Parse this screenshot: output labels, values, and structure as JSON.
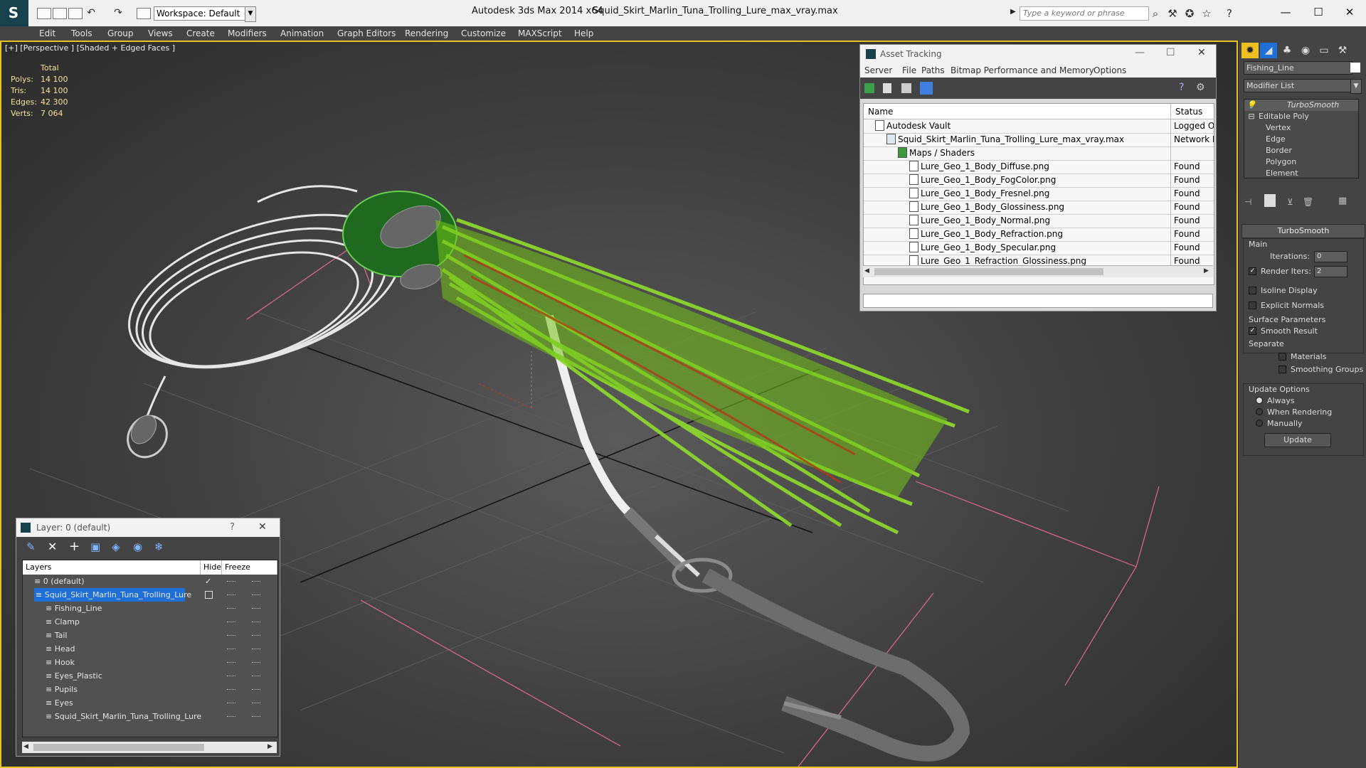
{
  "titlebar": {
    "app": "Autodesk 3ds Max  2014 x64",
    "file": "Squid_Skirt_Marlin_Tuna_Trolling_Lure_max_vray.max",
    "workspace": "Workspace: Default",
    "search_placeholder": "Type a keyword or phrase",
    "minimize": "—",
    "maximize": "☐",
    "close": "✕"
  },
  "menu": [
    "Edit",
    "Tools",
    "Group",
    "Views",
    "Create",
    "Modifiers",
    "Animation",
    "Graph Editors",
    "Rendering",
    "Customize",
    "MAXScript",
    "Help"
  ],
  "viewport": {
    "label": "[+] [Perspective ] [Shaded + Edged Faces ]",
    "stats_header": "Total",
    "stats": [
      {
        "label": "Polys:",
        "value": "14 100"
      },
      {
        "label": "Tris:",
        "value": "14 100"
      },
      {
        "label": "Edges:",
        "value": "42 300"
      },
      {
        "label": "Verts:",
        "value": "7 064"
      }
    ]
  },
  "asset": {
    "title": "Asset Tracking",
    "menu": [
      "Server",
      "File",
      "Paths",
      "Bitmap Performance and Memory",
      "Options"
    ],
    "col_name": "Name",
    "col_status": "Status",
    "rows": [
      {
        "name": "Autodesk Vault",
        "status": "Logged O",
        "indent": 1
      },
      {
        "name": "Squid_Skirt_Marlin_Tuna_Trolling_Lure_max_vray.max",
        "status": "Network F",
        "indent": 2
      },
      {
        "name": "Maps / Shaders",
        "status": "",
        "indent": 3
      },
      {
        "name": "Lure_Geo_1_Body_Diffuse.png",
        "status": "Found",
        "indent": 4
      },
      {
        "name": "Lure_Geo_1_Body_FogColor.png",
        "status": "Found",
        "indent": 4
      },
      {
        "name": "Lure_Geo_1_Body_Fresnel.png",
        "status": "Found",
        "indent": 4
      },
      {
        "name": "Lure_Geo_1_Body_Glossiness.png",
        "status": "Found",
        "indent": 4
      },
      {
        "name": "Lure_Geo_1_Body_Normal.png",
        "status": "Found",
        "indent": 4
      },
      {
        "name": "Lure_Geo_1_Body_Refraction.png",
        "status": "Found",
        "indent": 4
      },
      {
        "name": "Lure_Geo_1_Body_Specular.png",
        "status": "Found",
        "indent": 4
      },
      {
        "name": "Lure_Geo_1_Refraction_Glossiness.png",
        "status": "Found",
        "indent": 4
      }
    ]
  },
  "layer": {
    "title": "Layer: 0 (default)",
    "help": "?",
    "close": "✕",
    "col_layers": "Layers",
    "col_hide": "Hide",
    "col_freeze": "Freeze",
    "rows": [
      {
        "name": "0 (default)",
        "indent": 0
      },
      {
        "name": "Squid_Skirt_Marlin_Tuna_Trolling_Lure",
        "indent": 0
      },
      {
        "name": "Fishing_Line",
        "indent": 1
      },
      {
        "name": "Clamp",
        "indent": 1
      },
      {
        "name": "Tail",
        "indent": 1
      },
      {
        "name": "Head",
        "indent": 1
      },
      {
        "name": "Hook",
        "indent": 1
      },
      {
        "name": "Eyes_Plastic",
        "indent": 1
      },
      {
        "name": "Pupils",
        "indent": 1
      },
      {
        "name": "Eyes",
        "indent": 1
      },
      {
        "name": "Squid_Skirt_Marlin_Tuna_Trolling_Lure",
        "indent": 1
      }
    ]
  },
  "cmd": {
    "object_name": "Fishing_Line",
    "modifier_list": "Modifier List",
    "stack": [
      {
        "name": "TurboSmooth",
        "level": 0
      },
      {
        "name": "Editable Poly",
        "level": 0
      },
      {
        "name": "Vertex",
        "level": 1
      },
      {
        "name": "Edge",
        "level": 1
      },
      {
        "name": "Border",
        "level": 1
      },
      {
        "name": "Polygon",
        "level": 1
      },
      {
        "name": "Element",
        "level": 1
      }
    ],
    "rollout_title": "TurboSmooth",
    "main": "Main",
    "iterations_label": "Iterations:",
    "iterations_value": "0",
    "render_iters_label": "Render Iters:",
    "render_iters_value": "2",
    "isoline": "Isoline Display",
    "explicit_normals": "Explicit Normals",
    "surface_params": "Surface Parameters",
    "smooth_result": "Smooth Result",
    "separate": "Separate",
    "materials": "Materials",
    "smoothing_groups": "Smoothing Groups",
    "update_options": "Update Options",
    "always": "Always",
    "when_rendering": "When Rendering",
    "manually": "Manually",
    "update_btn": "Update"
  },
  "colors": {
    "viewport_border": "#e8c420",
    "lure_green": "#7cd11e",
    "selection_blue": "#1f6fd9"
  }
}
